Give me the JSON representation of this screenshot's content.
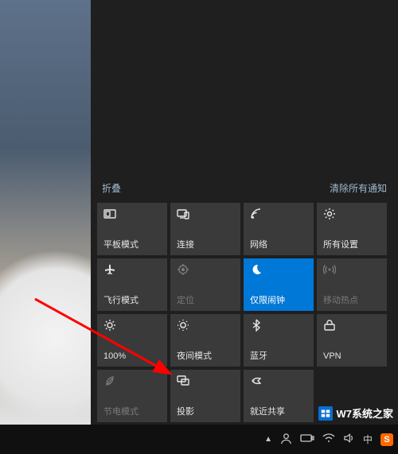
{
  "action_center": {
    "collapse_label": "折叠",
    "clear_label": "清除所有通知",
    "tiles": [
      {
        "name": "tablet-mode",
        "icon": "tablet",
        "label": "平板模式",
        "interactable": true
      },
      {
        "name": "connect",
        "icon": "connect",
        "label": "连接",
        "interactable": true
      },
      {
        "name": "network",
        "icon": "network",
        "label": "网络",
        "interactable": true
      },
      {
        "name": "all-settings",
        "icon": "gear",
        "label": "所有设置",
        "interactable": true
      },
      {
        "name": "airplane-mode",
        "icon": "airplane",
        "label": "飞行模式",
        "interactable": true
      },
      {
        "name": "location",
        "icon": "location",
        "label": "定位",
        "interactable": false
      },
      {
        "name": "quiet-hours",
        "icon": "moon",
        "label": "仅限闹钟",
        "interactable": true,
        "highlight": true
      },
      {
        "name": "mobile-hotspot",
        "icon": "hotspot",
        "label": "移动热点",
        "interactable": false
      },
      {
        "name": "brightness",
        "icon": "sun",
        "label": "100%",
        "interactable": true
      },
      {
        "name": "night-light",
        "icon": "night",
        "label": "夜间模式",
        "interactable": true
      },
      {
        "name": "bluetooth",
        "icon": "bluetooth",
        "label": "蓝牙",
        "interactable": true
      },
      {
        "name": "vpn",
        "icon": "vpn",
        "label": "VPN",
        "interactable": true
      },
      {
        "name": "battery-saver",
        "icon": "leaf",
        "label": "节电模式",
        "interactable": false
      },
      {
        "name": "project",
        "icon": "project",
        "label": "投影",
        "interactable": true
      },
      {
        "name": "nearby-share",
        "icon": "share",
        "label": "就近共享",
        "interactable": true
      }
    ]
  },
  "tray": {
    "ime_text": "中",
    "sogou_text": "S"
  },
  "watermark": {
    "text": "W7系统之家"
  }
}
